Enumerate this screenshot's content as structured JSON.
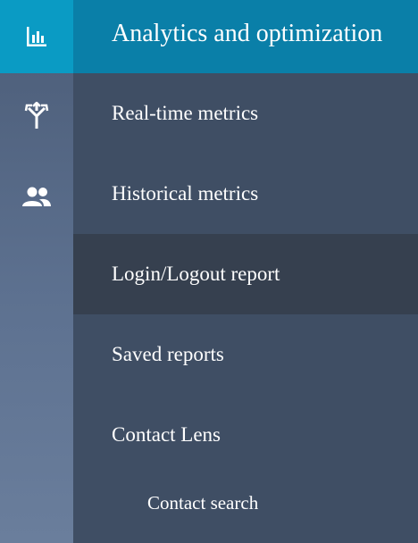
{
  "rail": {
    "items": [
      {
        "icon": "bar-chart-icon",
        "active": true
      },
      {
        "icon": "routing-icon",
        "active": false
      },
      {
        "icon": "users-icon",
        "active": false
      }
    ]
  },
  "panel": {
    "title": "Analytics and optimization",
    "items": [
      {
        "label": "Real-time metrics"
      },
      {
        "label": "Historical metrics"
      },
      {
        "label": "Login/Logout report",
        "selected": true
      },
      {
        "label": "Saved reports"
      },
      {
        "label": "Contact Lens"
      },
      {
        "label": "Contact search",
        "sub": true
      }
    ]
  },
  "colors": {
    "header_accent": "#0a7fa8",
    "rail_active": "#0a9bc4",
    "panel_bg": "#3f4e64",
    "selected_bg": "#36404f"
  }
}
